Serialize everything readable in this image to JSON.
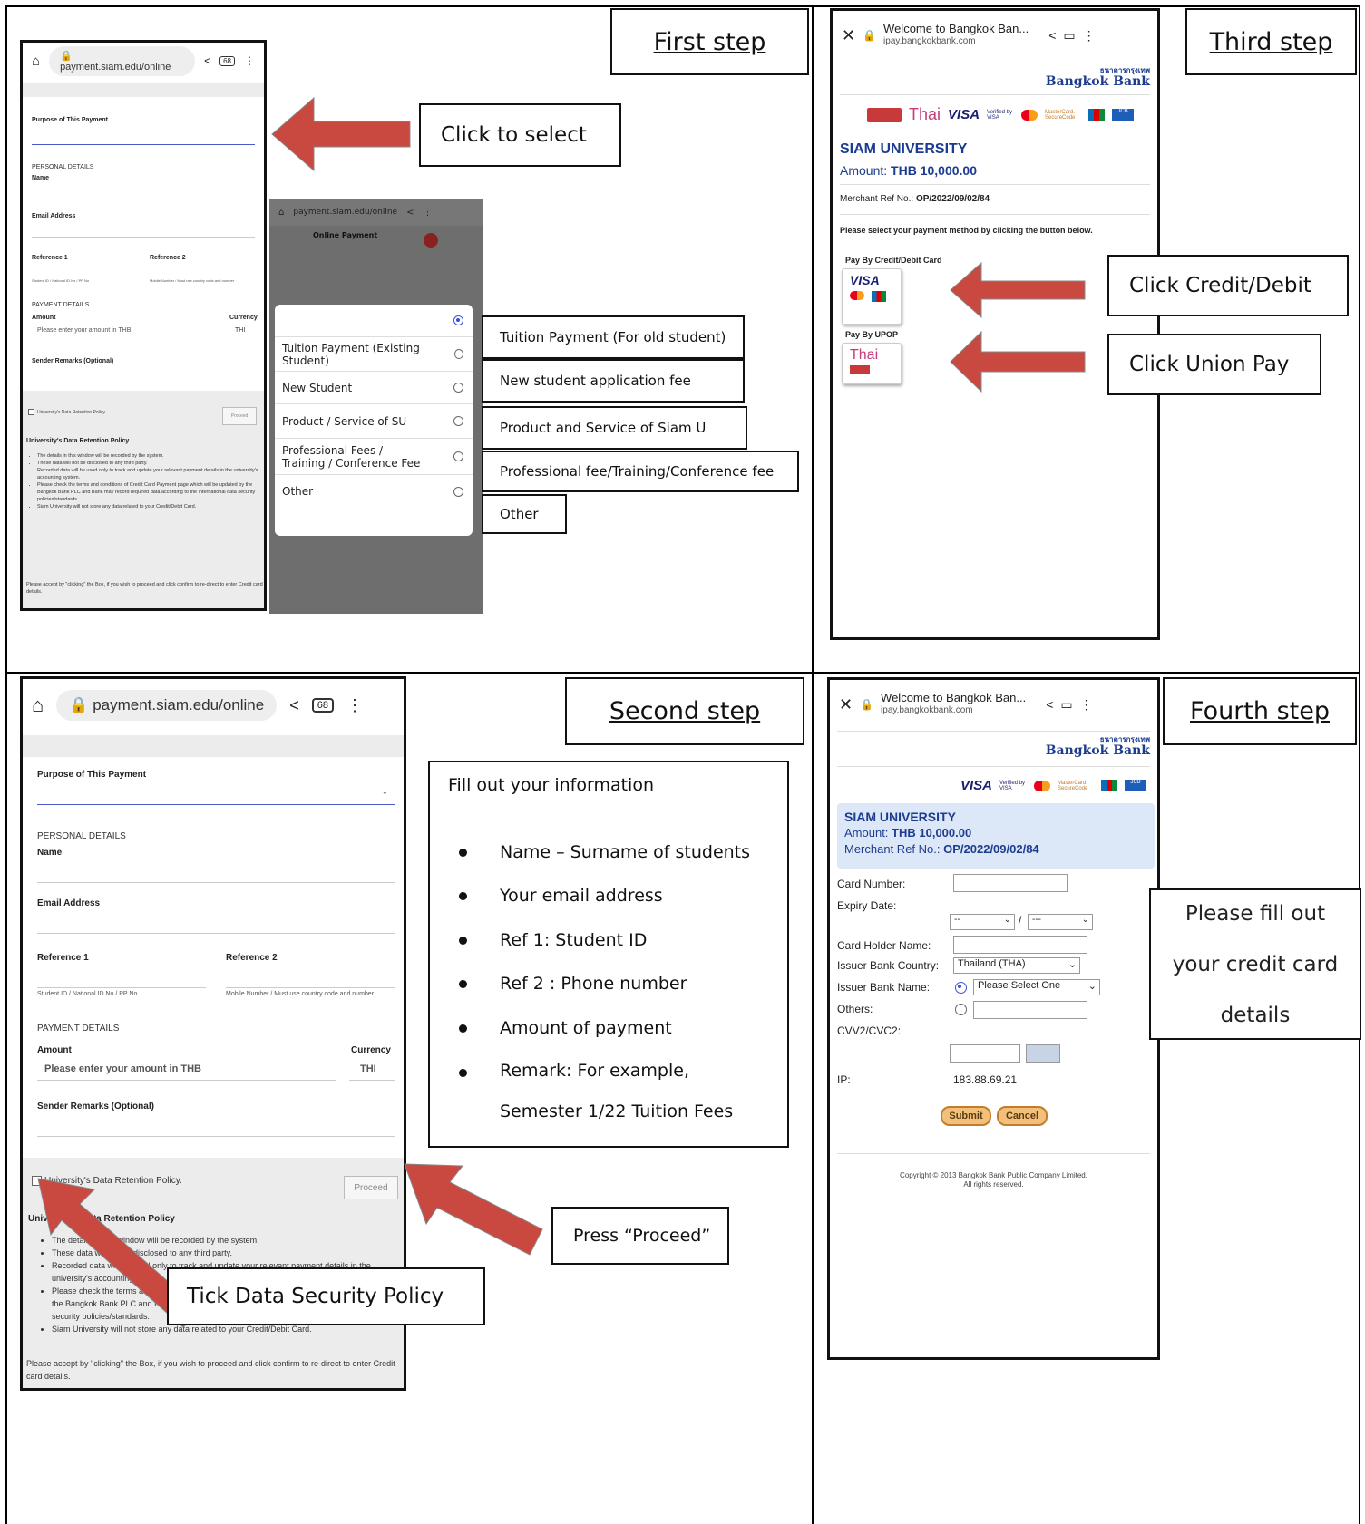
{
  "steps": {
    "first": "First step",
    "second": "Second step",
    "third": "Third step",
    "fourth": "Fourth step"
  },
  "colors": {
    "arrow": "#c9483f",
    "bank_blue": "#1d3c8f",
    "info_bg": "#dce8f7"
  },
  "browser1": {
    "url": "payment.siam.edu/online",
    "tab_count": "68",
    "purpose_label": "Purpose of This Payment",
    "personal_details": "PERSONAL DETAILS",
    "name_label": "Name",
    "email_label": "Email Address",
    "ref1_label": "Reference 1",
    "ref2_label": "Reference 2",
    "ref1_hint": "Student ID / National ID No / PP No",
    "ref2_hint": "Mobile Number / Must use country code and number",
    "payment_details": "PAYMENT DETAILS",
    "amount_label": "Amount",
    "currency_label": "Currency",
    "amount_placeholder": "Please enter your amount in THB",
    "currency_value": "THI",
    "remarks_label": "Sender Remarks (Optional)",
    "policy_checkbox": "University's Data Retention Policy.",
    "proceed": "Proceed",
    "policy_title": "University's Data Retention Policy",
    "policy_items": [
      "The details in this window will be recorded by the system.",
      "These data will not be disclosed to any third party.",
      "Recorded data will be used only to track and update your relevant payment details in the university's accounting system.",
      "Please check the terms and conditions of Credit Card Payment page which will be updated by the Bangkok Bank PLC and Bank may record required data according to the international data security policies/standards.",
      "Siam University will not store any data related to your Credit/Debit Card."
    ],
    "policy_footer": "Please accept by \"clicking\" the Box, if you wish to proceed and click confirm to re-direct to enter Credit card details."
  },
  "dropdown": {
    "header": "Online Payment",
    "options": [
      "",
      "Tuition Payment (Existing Student)",
      "New Student",
      "Product / Service of SU",
      "Professional Fees / Training / Conference Fee",
      "Other"
    ]
  },
  "callouts": {
    "click_select": "Click to select",
    "fees": [
      "Tuition Payment (For old student)",
      "New student application fee",
      "Product and Service of Siam U",
      "Professional fee/Training/Conference fee",
      "Other"
    ],
    "credit_debit": "Click Credit/Debit",
    "union_pay": "Click Union Pay",
    "press_proceed": "Press “Proceed”",
    "tick_policy": "Tick Data Security Policy",
    "fill_card": "Please fill out your credit card details"
  },
  "instructions": {
    "title": "Fill out your information",
    "items": [
      "Name – Surname of students",
      "Your email address",
      "Ref 1: Student ID",
      "Ref 2 : Phone number",
      "Amount of payment",
      "Remark: For example, Semester 1/22 Tuition Fees"
    ]
  },
  "bank": {
    "tab_title": "Welcome to Bangkok Ban...",
    "url": "ipay.bangkokbank.com",
    "bank_name": "Bangkok Bank",
    "bank_name_thai": "ธนาคารกรุงเทพ",
    "merchant": "SIAM UNIVERSITY",
    "amount_label": "Amount:",
    "amount_value": "THB 10,000.00",
    "ref_label": "Merchant Ref No.:",
    "ref_value": "OP/2022/09/02/84",
    "select_method": "Please select your payment method by clicking the button below.",
    "pay_card": "Pay By Credit/Debit Card",
    "pay_upop": "Pay By UPOP",
    "visa": "VISA",
    "thai": "Thai",
    "verified": "Verified by VISA",
    "mastercard": "MasterCard. SecureCode",
    "jcb": "JCB"
  },
  "card_form": {
    "card_number": "Card Number:",
    "expiry": "Expiry Date:",
    "expiry_month": "--",
    "expiry_sep": "/",
    "expiry_year": "---",
    "holder": "Card Holder Name:",
    "country": "Issuer Bank Country:",
    "country_value": "Thailand (THA)",
    "bank_name": "Issuer Bank Name:",
    "bank_select": "Please Select One",
    "others": "Others:",
    "cvv": "CVV2/CVC2:",
    "ip_label": "IP:",
    "ip_value": "183.88.69.21",
    "submit": "Submit",
    "cancel": "Cancel",
    "copyright": "Copyright © 2013 Bangkok Bank Public Company Limited.",
    "rights": "All rights reserved."
  }
}
